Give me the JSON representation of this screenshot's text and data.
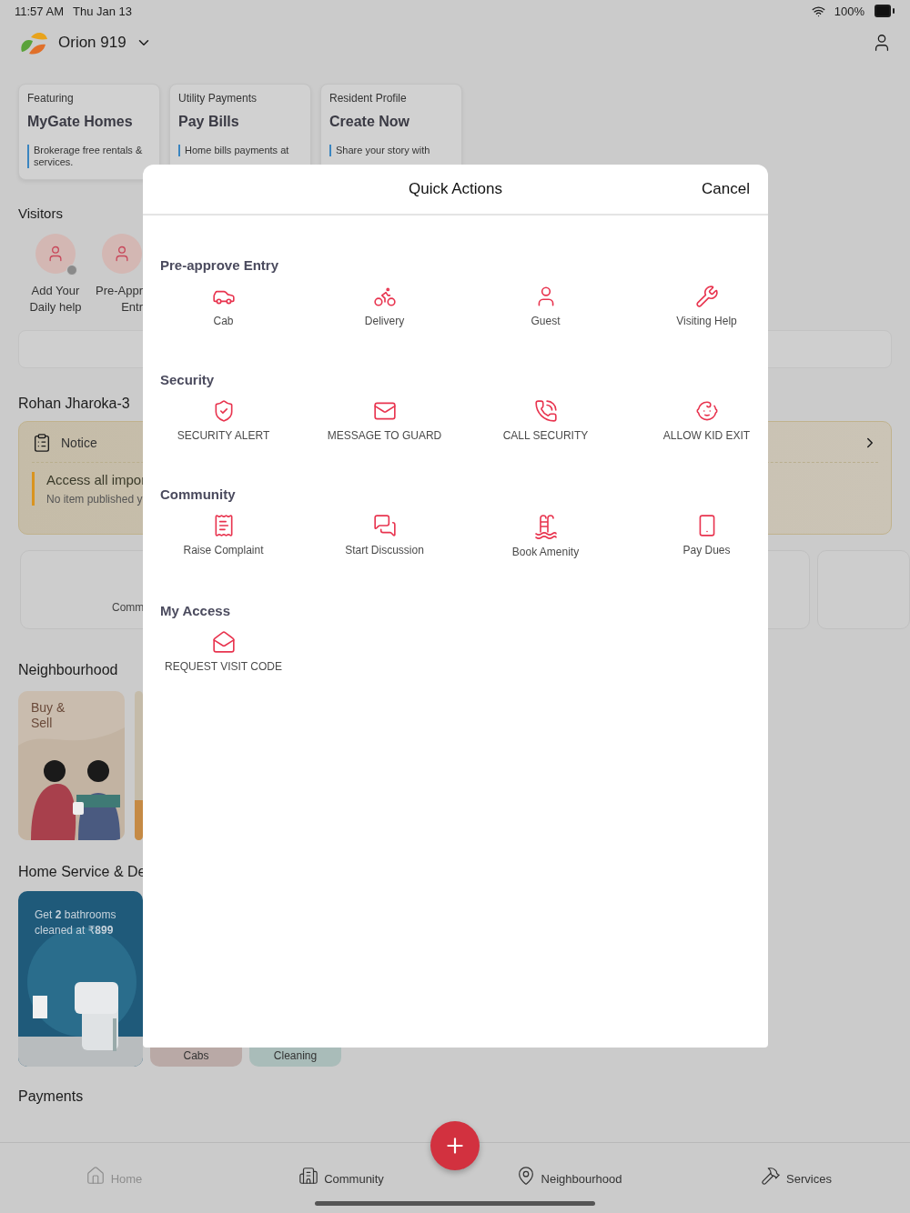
{
  "status_bar": {
    "time": "11:57 AM",
    "date": "Thu Jan 13",
    "battery": "100%"
  },
  "header": {
    "society": "Orion 919"
  },
  "promo_cards": [
    {
      "eyebrow": "Featuring",
      "title": "MyGate Homes",
      "description": "Brokerage free rentals & services."
    },
    {
      "eyebrow": "Utility Payments",
      "title": "Pay Bills",
      "description": "Home bills payments at"
    },
    {
      "eyebrow": "Resident Profile",
      "title": "Create Now",
      "description": "Share your story with"
    }
  ],
  "visitors": {
    "title": "Visitors",
    "items": [
      {
        "lines": [
          "Add Your",
          "Daily help"
        ],
        "badge": true
      },
      {
        "lines": [
          "Pre-Appr",
          "Entr"
        ],
        "badge": false
      }
    ]
  },
  "flat": {
    "title": "Rohan Jharoka-3",
    "notice": {
      "label": "Notice",
      "headline": "Access all impor",
      "subtext": "No item published y"
    },
    "shortcut": "Comm"
  },
  "neighbourhood": {
    "title": "Neighbourhood",
    "card": "Buy & Sell"
  },
  "home_service": {
    "title": "Home Service & De",
    "promo": "Get **2** bathrooms cleaned at ₹**899**",
    "tiles": [
      {
        "label": "Cabs",
        "color": "#b9a9a6"
      },
      {
        "label": "Cleaning",
        "color": "#a9bcb9"
      }
    ]
  },
  "payments": {
    "title": "Payments"
  },
  "quick_actions": {
    "title": "Quick Actions",
    "cancel": "Cancel",
    "sections": [
      {
        "title": "Pre-approve Entry",
        "items": [
          {
            "label": "Cab"
          },
          {
            "label": "Delivery"
          },
          {
            "label": "Guest"
          },
          {
            "label": "Visiting Help"
          }
        ]
      },
      {
        "title": "Security",
        "items": [
          {
            "label": "SECURITY ALERT"
          },
          {
            "label": "MESSAGE TO GUARD"
          },
          {
            "label": "CALL SECURITY"
          },
          {
            "label": "ALLOW KID EXIT"
          }
        ]
      },
      {
        "title": "Community",
        "items": [
          {
            "label": "Raise Complaint"
          },
          {
            "label": "Start Discussion"
          },
          {
            "label": "Book Amenity"
          },
          {
            "label": "Pay Dues"
          }
        ]
      },
      {
        "title": "My Access",
        "items": [
          {
            "label": "REQUEST VISIT CODE"
          }
        ]
      }
    ]
  },
  "bottom_nav": [
    {
      "label": "Home",
      "selected": true
    },
    {
      "label": "Community",
      "selected": false
    },
    {
      "label": "Neighbourhood",
      "selected": false
    },
    {
      "label": "Services",
      "selected": false
    }
  ]
}
